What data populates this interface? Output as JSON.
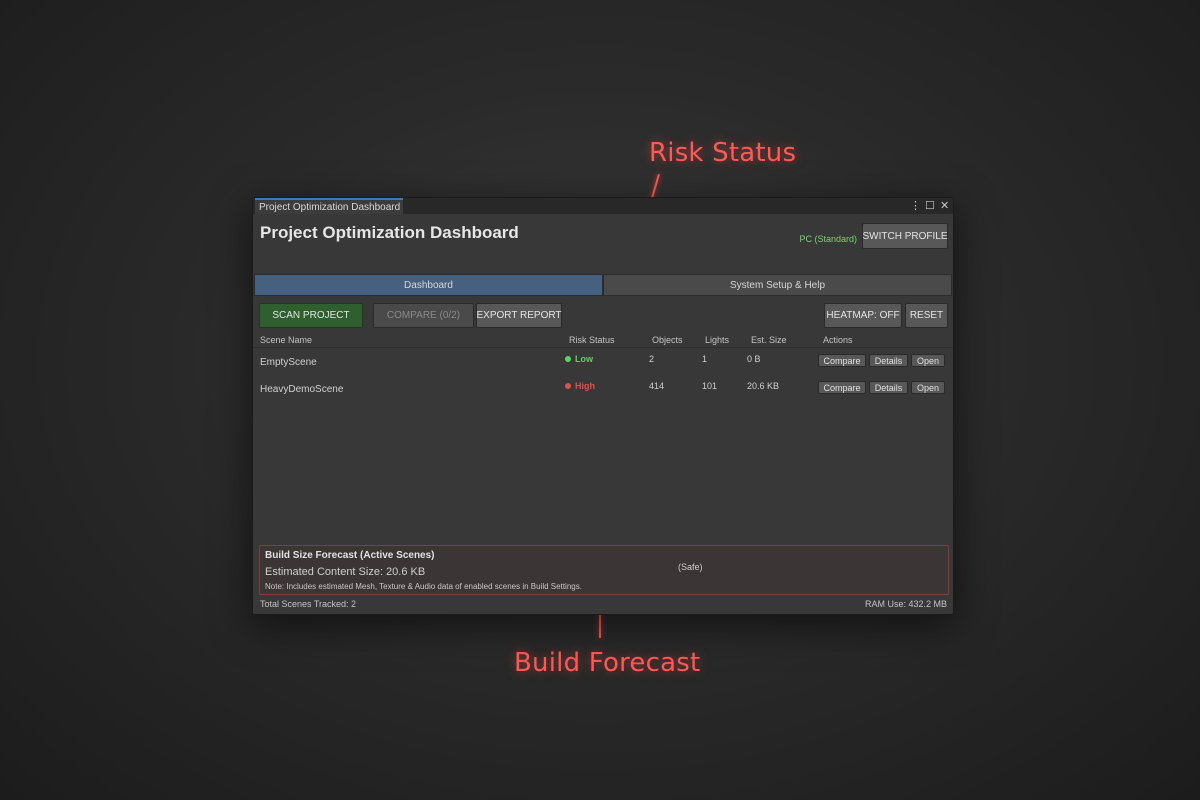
{
  "callouts": {
    "risk_label": "Risk Status",
    "forecast_label": "Build Forecast"
  },
  "window": {
    "tab_title": "Project Optimization Dashboard",
    "controls": [
      "⋮",
      "☐",
      "✕"
    ]
  },
  "header": {
    "title": "Project Optimization Dashboard",
    "platform": "PC (Standard)",
    "switch_profile": "SWITCH PROFILE"
  },
  "tabs": [
    {
      "label": "Dashboard",
      "active": true
    },
    {
      "label": "System Setup & Help",
      "active": false
    }
  ],
  "toolbar": {
    "scan": "SCAN PROJECT",
    "compare": "COMPARE (0/2)",
    "export": "EXPORT REPORT",
    "heatmap": "HEATMAP: OFF",
    "reset": "RESET"
  },
  "table": {
    "headers": {
      "name": "Scene Name",
      "risk": "Risk Status",
      "objects": "Objects",
      "lights": "Lights",
      "size": "Est. Size",
      "actions": "Actions"
    },
    "rows": [
      {
        "name": "EmptyScene",
        "risk": "Low",
        "risk_color": "#5fd35f",
        "objects": "2",
        "lights": "1",
        "size": "0 B"
      },
      {
        "name": "HeavyDemoScene",
        "risk": "High",
        "risk_color": "#e05050",
        "objects": "414",
        "lights": "101",
        "size": "20.6 KB"
      }
    ],
    "row_actions": {
      "compare": "Compare",
      "details": "Details",
      "open": "Open"
    }
  },
  "forecast": {
    "title": "Build Size Forecast (Active Scenes)",
    "estimated": "Estimated Content Size: 20.6 KB",
    "state": "(Safe)",
    "note": "Note: Includes estimated Mesh, Texture & Audio data of enabled scenes in Build Settings."
  },
  "footer": {
    "total": "Total Scenes Tracked: 2",
    "ram": "RAM Use: 432.2 MB"
  },
  "colors": {
    "accent_tab": "#46607f",
    "scan_button": "#2f5f2f",
    "callout": "#ff5a55",
    "platform_text": "#6fd86f"
  }
}
